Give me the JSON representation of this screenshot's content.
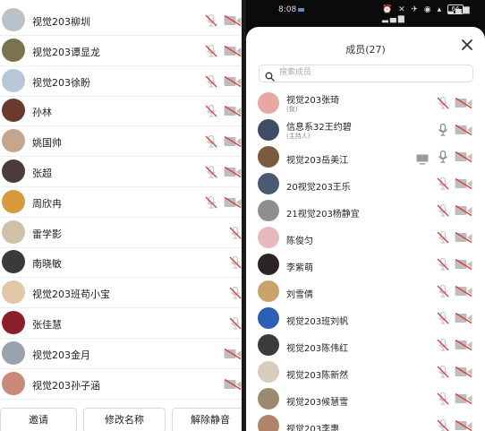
{
  "left_panel": {
    "members": [
      {
        "name": "视觉203柳圳",
        "avatar": "#b9c2c9",
        "mic": "muted",
        "cam": "off"
      },
      {
        "name": "视觉203谭显龙",
        "avatar": "#7a7350",
        "mic": "muted",
        "cam": "off"
      },
      {
        "name": "视觉203徐盼",
        "avatar": "#b7c7d8",
        "mic": "muted",
        "cam": "off"
      },
      {
        "name": "孙林",
        "avatar": "#6b3a2f",
        "mic": "muted",
        "cam": "off"
      },
      {
        "name": "姚国帅",
        "avatar": "#c5a58c",
        "mic": "muted",
        "cam": "off"
      },
      {
        "name": "张超",
        "avatar": "#4a3d3b",
        "mic": "muted",
        "cam": "off"
      },
      {
        "name": "周欣冉",
        "avatar": "#d79a3a",
        "mic": "muted",
        "cam": "off"
      },
      {
        "name": "雷学影",
        "avatar": "#cfc0a8",
        "mic": "muted",
        "cam": "none"
      },
      {
        "name": "南晓敏",
        "avatar": "#3a3a3a",
        "mic": "muted",
        "cam": "none"
      },
      {
        "name": "视觉203班苟小宝",
        "avatar": "#e0c7a6",
        "mic": "muted",
        "cam": "none"
      },
      {
        "name": "张佳慧",
        "avatar": "#8b1e2a",
        "mic": "muted",
        "cam": "none"
      },
      {
        "name": "视觉203金月",
        "avatar": "#9aa3ab",
        "mic": "none",
        "cam": "off"
      },
      {
        "name": "视觉203孙子涵",
        "avatar": "#c98a7a",
        "mic": "none",
        "cam": "off"
      }
    ],
    "buttons": {
      "invite": "邀请",
      "rename": "修改名称",
      "unmute_all": "解除静音"
    }
  },
  "phone": {
    "status": {
      "time": "8:08",
      "battery": "66"
    },
    "title": "成员(27)",
    "search_placeholder": "搜索成员",
    "members": [
      {
        "name": "视觉203张琦",
        "role": "(我)",
        "avatar": "#e8a7a2",
        "mic": "muted",
        "cam": "off"
      },
      {
        "name": "信息系32王约碧",
        "role": "(主持人)",
        "avatar": "#3d4d66",
        "mic": "on",
        "cam": "off"
      },
      {
        "name": "视觉203岳美江",
        "avatar": "#7b5a3e",
        "mic": "on",
        "cam": "off",
        "screen": true
      },
      {
        "name": "20视觉203王乐",
        "avatar": "#4a5a72",
        "mic": "muted",
        "cam": "off"
      },
      {
        "name": "21视觉203杨静宜",
        "avatar": "#8f8f8f",
        "mic": "muted",
        "cam": "off"
      },
      {
        "name": "陈俊匀",
        "avatar": "#e6b9bd",
        "mic": "muted",
        "cam": "off"
      },
      {
        "name": "李紫萌",
        "avatar": "#2c2424",
        "mic": "muted",
        "cam": "off"
      },
      {
        "name": "刘雪倩",
        "avatar": "#c9a36a",
        "mic": "muted",
        "cam": "off"
      },
      {
        "name": "视觉203班刘帆",
        "avatar": "#2c5fb8",
        "mic": "muted",
        "cam": "off"
      },
      {
        "name": "视觉203陈伟红",
        "avatar": "#3b3b3b",
        "mic": "muted",
        "cam": "off"
      },
      {
        "name": "视觉203陈新然",
        "avatar": "#d8cdbc",
        "mic": "muted",
        "cam": "off"
      },
      {
        "name": "视觉203候慧雪",
        "avatar": "#9c8a6e",
        "mic": "muted",
        "cam": "off"
      },
      {
        "name": "视觉203李惠",
        "avatar": "#b08468",
        "mic": "muted",
        "cam": "off"
      }
    ]
  },
  "colors": {
    "muted": "#c8c8c8",
    "off": "#e03b3b",
    "on": "#8a8a8a",
    "cam_body": "#bdbdbd",
    "title": "#333333"
  }
}
